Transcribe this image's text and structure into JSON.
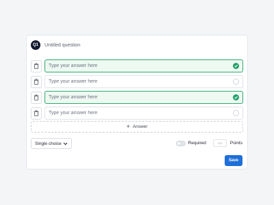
{
  "question": {
    "badge": "Q1",
    "title": "Untitled question"
  },
  "answers": [
    {
      "placeholder": "Type your answer here",
      "correct": true
    },
    {
      "placeholder": "Type your answer here",
      "correct": false
    },
    {
      "placeholder": "Type your answer here",
      "correct": true
    },
    {
      "placeholder": "Type your answer here",
      "correct": false
    }
  ],
  "add_answer_label": "Answer",
  "type_select": {
    "value": "Single choice"
  },
  "required": {
    "label": "Required",
    "enabled": false
  },
  "points": {
    "value": "123",
    "label": "Points"
  },
  "save_label": "Save",
  "colors": {
    "accent": "#1f6fd9",
    "correct_border": "#2ea96a",
    "correct_fill": "#eef9f2",
    "badge": "#141a2e"
  },
  "icons": {
    "delete": "trash-icon",
    "correct": "check-circle-icon",
    "add": "plus-icon",
    "dropdown": "chevron-down-icon"
  }
}
